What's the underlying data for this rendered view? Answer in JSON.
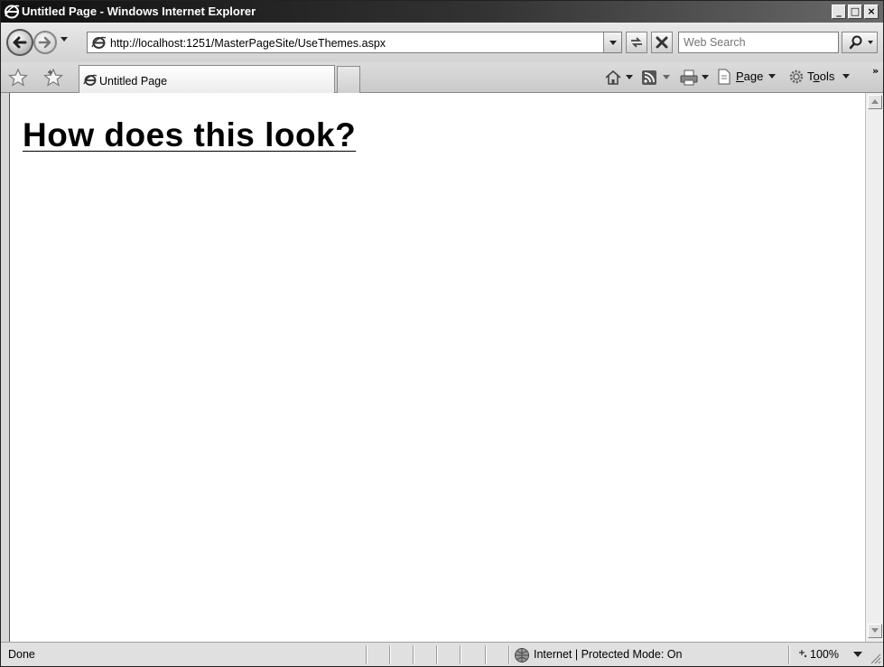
{
  "window": {
    "title": "Untitled Page - Windows Internet Explorer",
    "minimize_glyph": "_",
    "maximize_glyph": "□",
    "close_glyph": "×"
  },
  "address_bar": {
    "url": "http://localhost:1251/MasterPageSite/UseThemes.aspx"
  },
  "search": {
    "placeholder": "Web Search"
  },
  "tab": {
    "label": "Untitled Page"
  },
  "command_bar": {
    "page_label_accel": "P",
    "page_label_rest": "age",
    "tools_label_pre": "T",
    "tools_label_accel": "o",
    "tools_label_rest": "ols",
    "overflow_glyph": "»"
  },
  "content": {
    "heading": "How does this look?"
  },
  "status_bar": {
    "status": "Done",
    "zone": "Internet | Protected Mode: On",
    "zoom": "100%"
  },
  "colors": {
    "titlebar_dark": "#111111",
    "chrome": "#d8d8d8",
    "content_bg": "#ffffff"
  }
}
